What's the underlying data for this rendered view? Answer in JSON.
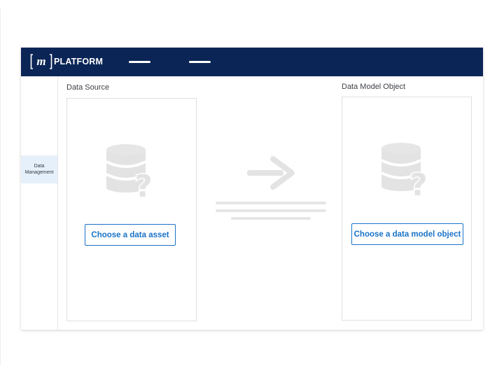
{
  "header": {
    "brand_text": "PLATFORM",
    "logo_letter": "m",
    "background": "#0b2556"
  },
  "sidebar": {
    "items": [
      {
        "label_line1": "Data",
        "label_line2": "Management",
        "active": true
      }
    ]
  },
  "source_panel": {
    "title": "Data Source",
    "button_label": "Choose a data asset",
    "icon": "database-question-icon"
  },
  "target_panel": {
    "title": "Data Model Object",
    "button_label": "Choose a data model object",
    "icon": "database-question-icon"
  },
  "connector": {
    "icon": "arrow-right-icon"
  },
  "colors": {
    "accent": "#1a73c7",
    "active_nav": "#e6f0fa",
    "placeholder_gray": "#e3e3e3"
  }
}
